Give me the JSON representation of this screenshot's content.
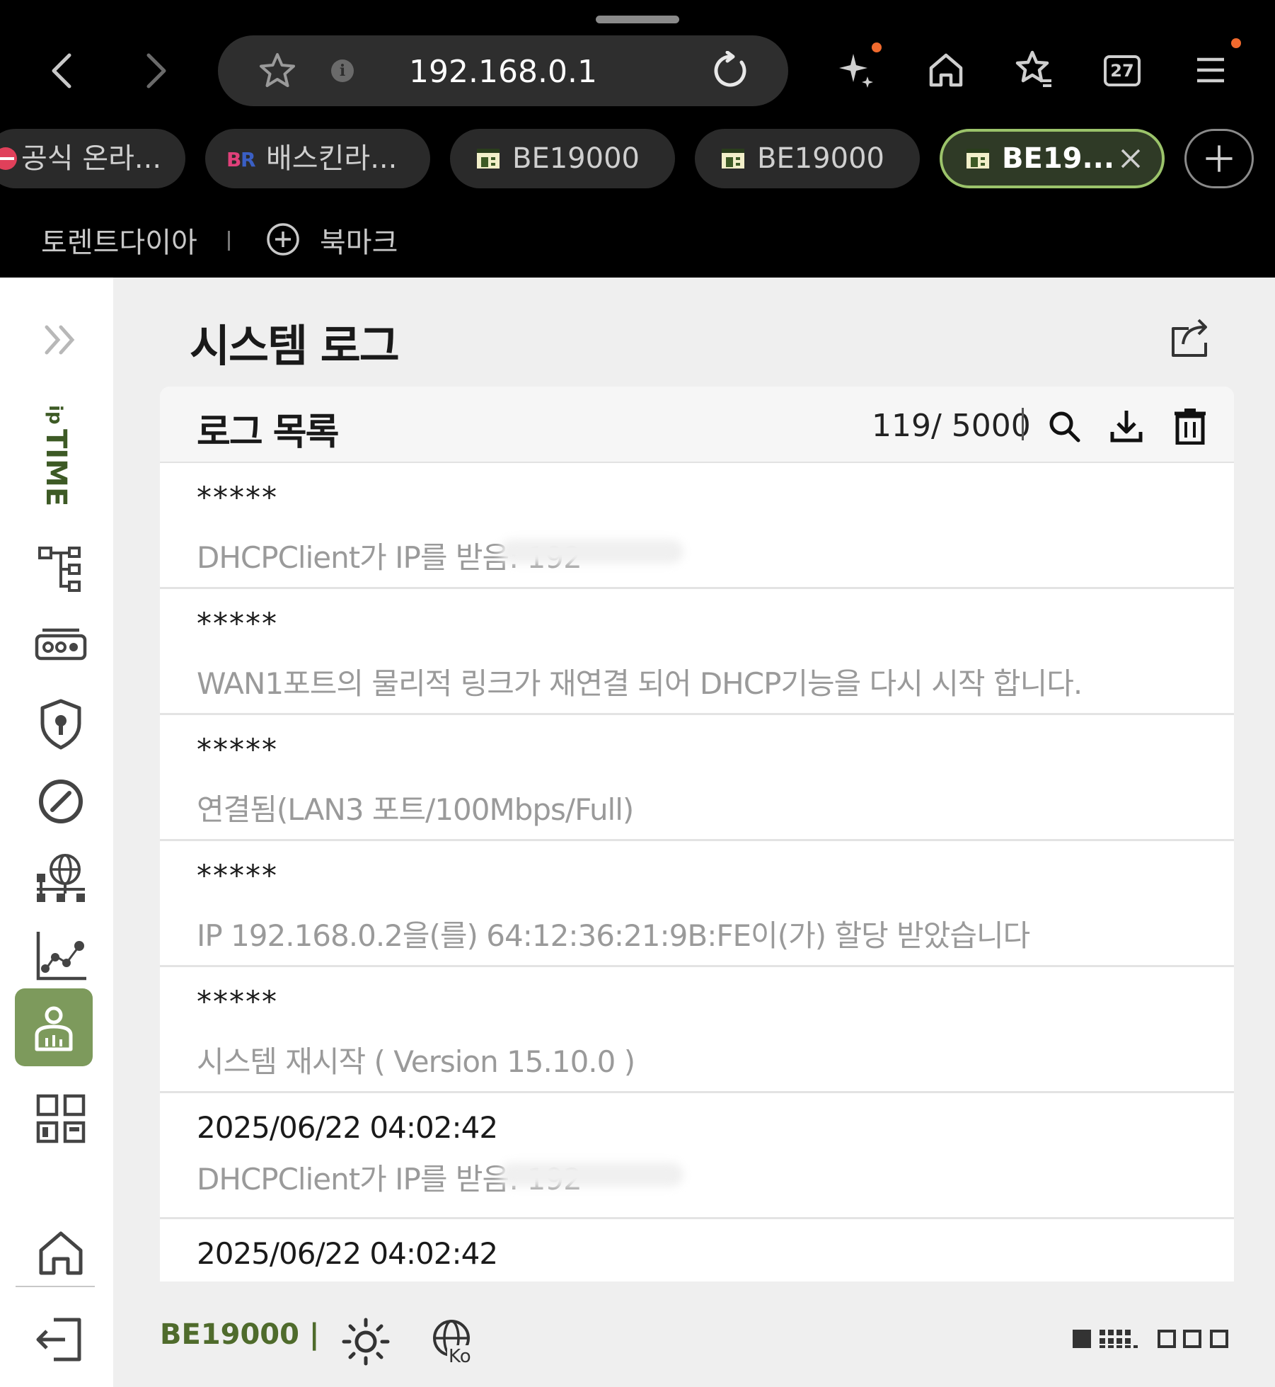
{
  "browser": {
    "url": "192.168.0.1",
    "tab_count": "27",
    "tabs": [
      {
        "label": "공식 온라..."
      },
      {
        "label": "배스킨라..."
      },
      {
        "label": "BE19000"
      },
      {
        "label": "BE19000"
      },
      {
        "label": "BE19..."
      }
    ],
    "bookmarks": {
      "item": "토렌트다이아",
      "add_label": "북마크"
    }
  },
  "sidebar": {
    "logo_text": "ipTIME",
    "items": [
      "network-tree-icon",
      "router-icon",
      "security-shield-icon",
      "speed-gauge-icon",
      "global-network-icon",
      "stats-chart-icon",
      "admin-system-icon",
      "apps-grid-icon"
    ],
    "home": "home-icon",
    "logout": "logout-icon"
  },
  "page": {
    "title": "시스템 로그",
    "card_title": "로그 목록",
    "count": "119/ 5000"
  },
  "logs": [
    {
      "time": "*****",
      "message": "DHCPClient가 IP를 받음: 192"
    },
    {
      "time": "*****",
      "message": "WAN1포트의 물리적 링크가 재연결 되어 DHCP기능을 다시 시작 합니다."
    },
    {
      "time": "*****",
      "message": "연결됨(LAN3 포트/100Mbps/Full)"
    },
    {
      "time": "*****",
      "message": "IP 192.168.0.2을(를) 64:12:36:21:9B:FE이(가) 할당 받았습니다"
    },
    {
      "time": "*****",
      "message": "시스템 재시작 ( Version 15.10.0 )"
    },
    {
      "time": "2025/06/22  04:02:42",
      "message": "DHCPClient가 IP를 받음: 192"
    },
    {
      "time": "2025/06/22  04:02:42",
      "message": ""
    }
  ],
  "footer": {
    "model": "BE19000 |",
    "lang": "Ko"
  },
  "colors": {
    "accent": "#7d9a5c",
    "brand_green": "#4f6b2c",
    "active_tab_border": "#9bc36a",
    "notification_dot": "#f06a2e"
  }
}
